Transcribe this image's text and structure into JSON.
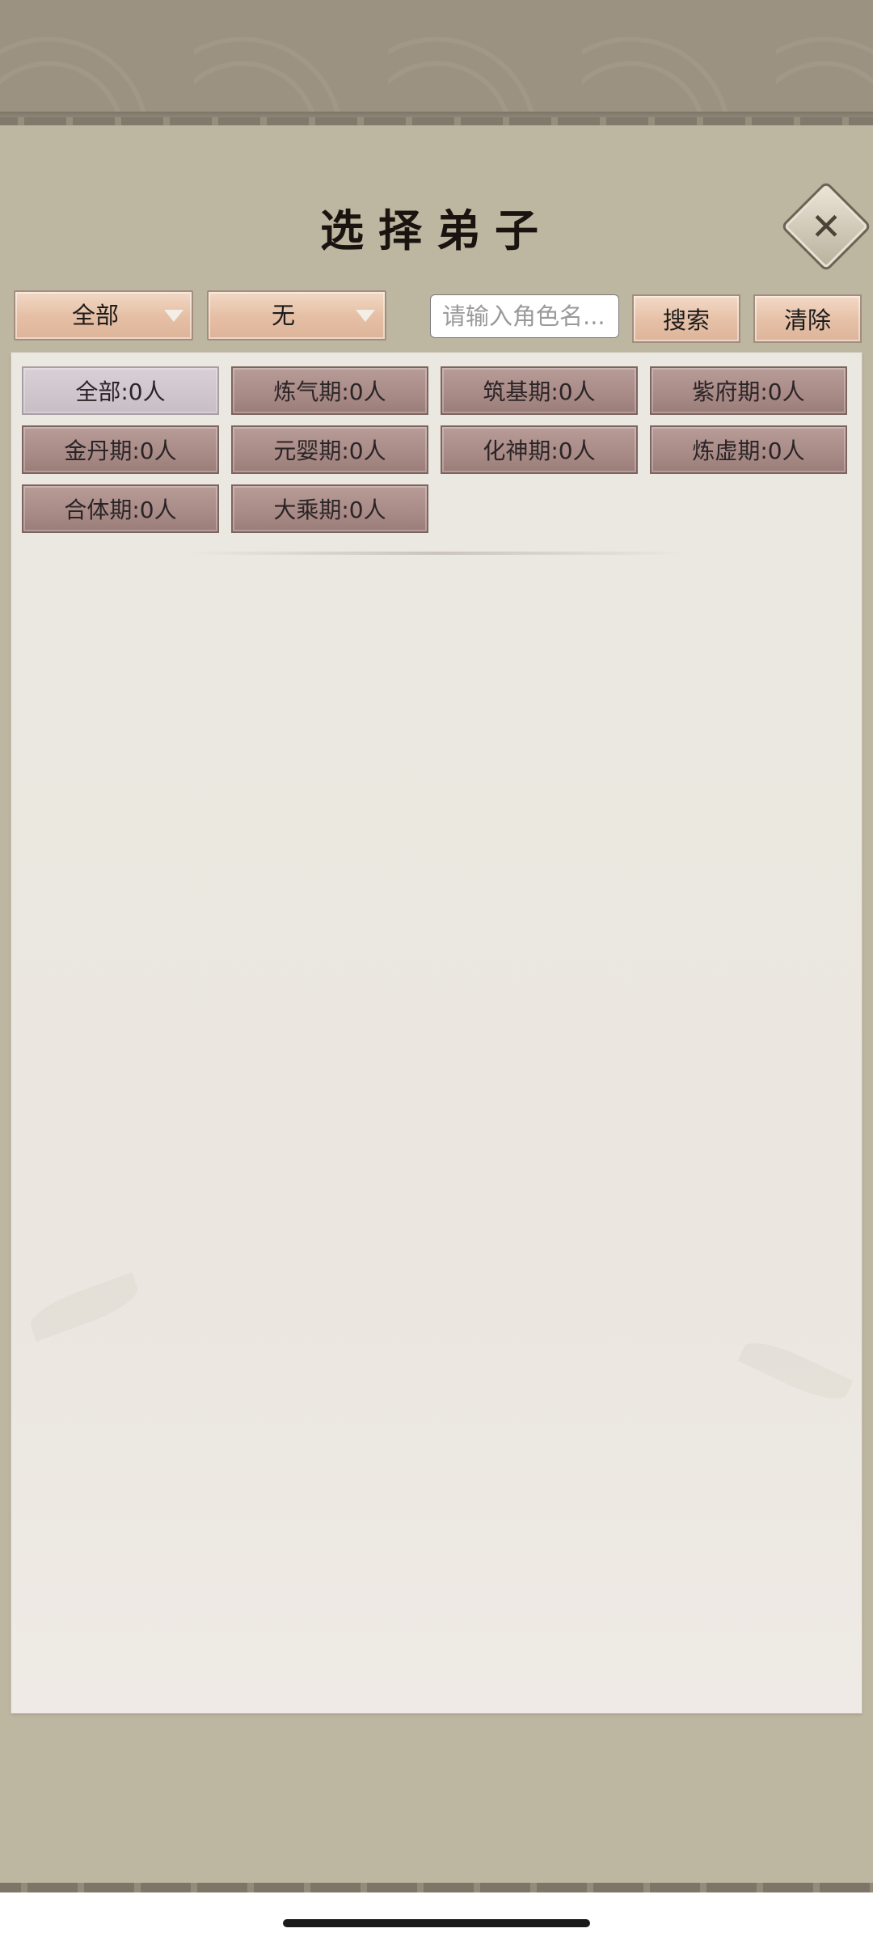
{
  "dialog": {
    "title": "选择弟子",
    "close_icon": "close-icon"
  },
  "filters": {
    "scope_dropdown": {
      "selected": "全部"
    },
    "type_dropdown": {
      "selected": "无"
    },
    "search": {
      "placeholder": "请输入角色名..."
    },
    "search_button": "搜索",
    "clear_button": "清除"
  },
  "realms": [
    {
      "label": "全部:0人",
      "active": true
    },
    {
      "label": "炼气期:0人",
      "active": false
    },
    {
      "label": "筑基期:0人",
      "active": false
    },
    {
      "label": "紫府期:0人",
      "active": false
    },
    {
      "label": "金丹期:0人",
      "active": false
    },
    {
      "label": "元婴期:0人",
      "active": false
    },
    {
      "label": "化神期:0人",
      "active": false
    },
    {
      "label": "炼虚期:0人",
      "active": false
    },
    {
      "label": "合体期:0人",
      "active": false
    },
    {
      "label": "大乘期:0人",
      "active": false
    }
  ],
  "colors": {
    "panel_bg": "#bdb6a0",
    "chip_bg": "#a88a86",
    "chip_active_bg": "#cec6cc",
    "button_bg": "#e6c0a6"
  }
}
